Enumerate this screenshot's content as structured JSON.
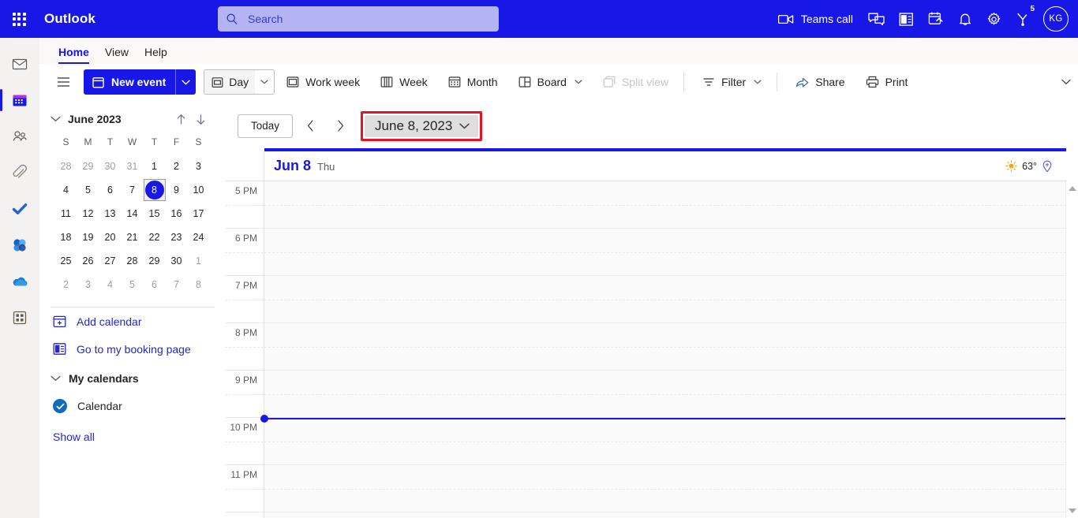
{
  "header": {
    "brand": "Outlook",
    "waffle_label": "app-launcher",
    "search_placeholder": "Search",
    "search_value": "",
    "teams_call": "Teams call",
    "icons": [
      "chat-icon",
      "office-icon",
      "tasks-icon",
      "bell-icon",
      "gear-icon",
      "diagnostics-icon"
    ],
    "notification_badge": "5",
    "avatar_initials": "KG",
    "bg_color": "#1717e8",
    "search_bg": "#b4b4f4"
  },
  "rail": {
    "items": [
      {
        "name": "mail",
        "label": "Mail",
        "active": false
      },
      {
        "name": "calendar",
        "label": "Calendar",
        "active": true
      },
      {
        "name": "people",
        "label": "People",
        "active": false
      },
      {
        "name": "files",
        "label": "Files",
        "active": false
      },
      {
        "name": "todo",
        "label": "To Do",
        "active": false
      },
      {
        "name": "viva",
        "label": "Viva Engage",
        "active": false
      },
      {
        "name": "onedrive",
        "label": "OneDrive",
        "active": false
      },
      {
        "name": "apps",
        "label": "Apps",
        "active": false
      }
    ]
  },
  "ribbon": {
    "tabs": [
      {
        "label": "Home",
        "active": true
      },
      {
        "label": "View",
        "active": false
      },
      {
        "label": "Help",
        "active": false
      }
    ],
    "new_event": "New event",
    "view_current": "Day",
    "buttons": [
      {
        "label": "Work week",
        "icon": "workweek-icon",
        "disabled": false,
        "caret": false
      },
      {
        "label": "Week",
        "icon": "week-icon",
        "disabled": false,
        "caret": false
      },
      {
        "label": "Month",
        "icon": "month-icon",
        "disabled": false,
        "caret": false
      },
      {
        "label": "Board",
        "icon": "board-icon",
        "disabled": false,
        "caret": true
      },
      {
        "label": "Split view",
        "icon": "splitview-icon",
        "disabled": true,
        "caret": false
      }
    ],
    "right_buttons": [
      {
        "label": "Filter",
        "icon": "filter-icon",
        "caret": true
      },
      {
        "label": "Share",
        "icon": "share-icon",
        "caret": false
      },
      {
        "label": "Print",
        "icon": "print-icon",
        "caret": false
      }
    ]
  },
  "sidebar": {
    "mini_calendar": {
      "title": "June 2023",
      "day_initials": [
        "S",
        "M",
        "T",
        "W",
        "T",
        "F",
        "S"
      ],
      "weeks": [
        [
          {
            "d": "28",
            "o": true
          },
          {
            "d": "29",
            "o": true
          },
          {
            "d": "30",
            "o": true
          },
          {
            "d": "31",
            "o": true
          },
          {
            "d": "1",
            "o": false
          },
          {
            "d": "2",
            "o": false
          },
          {
            "d": "3",
            "o": false
          }
        ],
        [
          {
            "d": "4",
            "o": false
          },
          {
            "d": "5",
            "o": false
          },
          {
            "d": "6",
            "o": false
          },
          {
            "d": "7",
            "o": false
          },
          {
            "d": "8",
            "o": false,
            "sel": true
          },
          {
            "d": "9",
            "o": false
          },
          {
            "d": "10",
            "o": false
          }
        ],
        [
          {
            "d": "11",
            "o": false
          },
          {
            "d": "12",
            "o": false
          },
          {
            "d": "13",
            "o": false
          },
          {
            "d": "14",
            "o": false
          },
          {
            "d": "15",
            "o": false
          },
          {
            "d": "16",
            "o": false
          },
          {
            "d": "17",
            "o": false
          }
        ],
        [
          {
            "d": "18",
            "o": false
          },
          {
            "d": "19",
            "o": false
          },
          {
            "d": "20",
            "o": false
          },
          {
            "d": "21",
            "o": false
          },
          {
            "d": "22",
            "o": false
          },
          {
            "d": "23",
            "o": false
          },
          {
            "d": "24",
            "o": false
          }
        ],
        [
          {
            "d": "25",
            "o": false
          },
          {
            "d": "26",
            "o": false
          },
          {
            "d": "27",
            "o": false
          },
          {
            "d": "28",
            "o": false
          },
          {
            "d": "29",
            "o": false
          },
          {
            "d": "30",
            "o": false
          },
          {
            "d": "1",
            "o": true
          }
        ],
        [
          {
            "d": "2",
            "o": true
          },
          {
            "d": "3",
            "o": true
          },
          {
            "d": "4",
            "o": true
          },
          {
            "d": "5",
            "o": true
          },
          {
            "d": "6",
            "o": true
          },
          {
            "d": "7",
            "o": true
          },
          {
            "d": "8",
            "o": true
          }
        ]
      ]
    },
    "add_calendar": "Add calendar",
    "booking_page": "Go to my booking page",
    "my_calendars": "My calendars",
    "calendar_item": "Calendar",
    "show_all": "Show all"
  },
  "main": {
    "today_button": "Today",
    "prev_label": "Previous day",
    "next_label": "Next day",
    "date_picker": "June 8, 2023",
    "date_picker_highlight_color": "#e81123",
    "day_header": {
      "date": "Jun 8",
      "dow": "Thu"
    },
    "weather": {
      "temp": "63°",
      "icon": "sun-icon",
      "location_icon": "location-pin-icon"
    },
    "time_labels": [
      "5 PM",
      "6 PM",
      "7 PM",
      "8 PM",
      "9 PM",
      "10 PM",
      "11 PM"
    ],
    "now_indicator_label": "current-time",
    "scrollbar_thumb_color": "#00c896"
  }
}
